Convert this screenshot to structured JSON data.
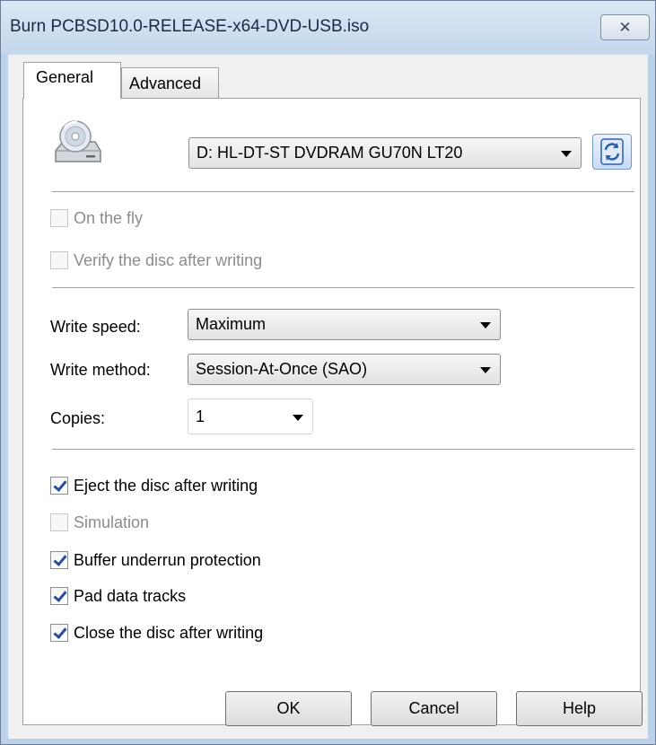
{
  "window": {
    "title": "Burn PCBSD10.0-RELEASE-x64-DVD-USB.iso",
    "close_glyph": "✕"
  },
  "tabs": [
    {
      "label": "General",
      "active": true
    },
    {
      "label": "Advanced",
      "active": false
    }
  ],
  "drive": {
    "icon": "optical-drive-icon",
    "selected": "D: HL-DT-ST DVDRAM GU70N LT20",
    "refresh_icon": "refresh-icon"
  },
  "options_top": [
    {
      "label": "On the fly",
      "checked": false,
      "disabled": true
    },
    {
      "label": "Verify the disc after writing",
      "checked": false,
      "disabled": true
    }
  ],
  "settings": {
    "write_speed_label": "Write speed:",
    "write_speed_value": "Maximum",
    "write_method_label": "Write method:",
    "write_method_value": "Session-At-Once (SAO)",
    "copies_label": "Copies:",
    "copies_value": "1"
  },
  "options_bottom": [
    {
      "label": "Eject the disc after writing",
      "checked": true,
      "disabled": false
    },
    {
      "label": "Simulation",
      "checked": false,
      "disabled": true
    },
    {
      "label": "Buffer underrun protection",
      "checked": true,
      "disabled": false
    },
    {
      "label": "Pad data tracks",
      "checked": true,
      "disabled": false
    },
    {
      "label": "Close the disc after writing",
      "checked": true,
      "disabled": false
    }
  ],
  "buttons": {
    "ok": "OK",
    "cancel": "Cancel",
    "help": "Help"
  },
  "colors": {
    "checkmark": "#2a4d9b",
    "disabled_text": "#8c8c8c"
  }
}
